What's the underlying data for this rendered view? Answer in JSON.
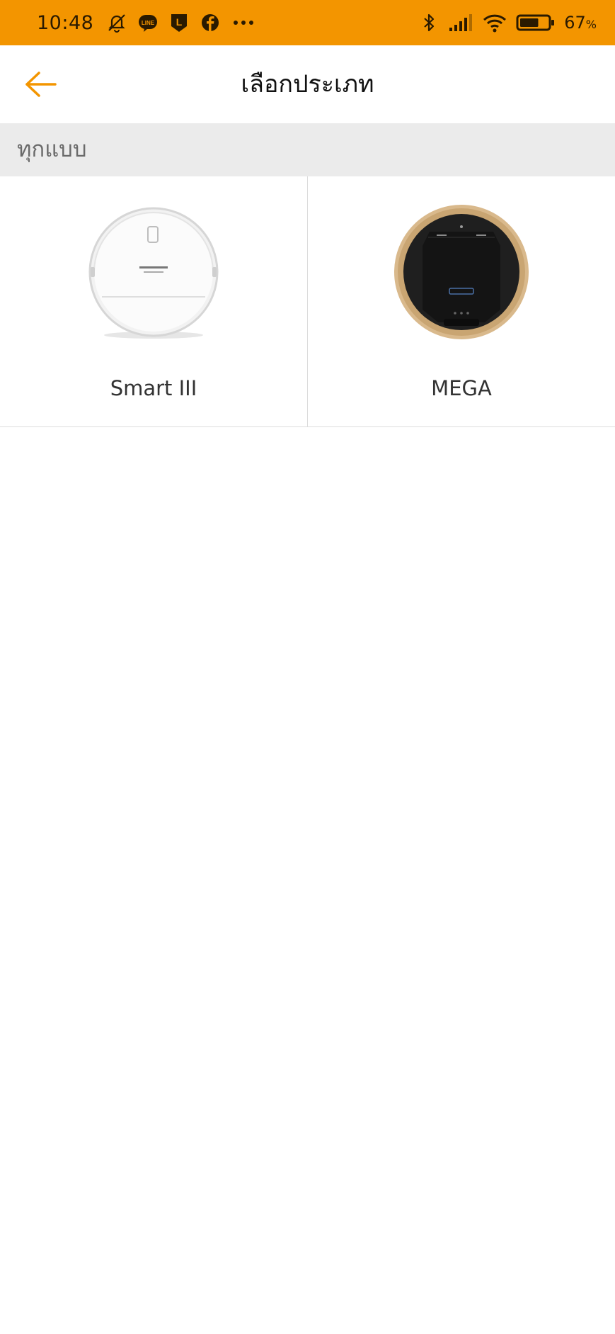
{
  "status_bar": {
    "time": "10:48",
    "notification_icons": [
      "mute-bell-icon",
      "line-icon",
      "l-app-icon",
      "facebook-icon",
      "more-dots-icon"
    ],
    "line_text": "LINE",
    "l_text": "L",
    "right_icons": [
      "bluetooth-icon",
      "signal-icon",
      "wifi-icon",
      "battery-icon"
    ],
    "battery_percent": "67",
    "battery_unit": "%",
    "battery_level": 0.67,
    "background_color": "#f39500"
  },
  "app_bar": {
    "title": "เลือกประเภท",
    "back_icon": "arrow-left-icon",
    "accent_color": "#f39500"
  },
  "section": {
    "label": "ทุกแบบ"
  },
  "products": [
    {
      "name": "Smart III",
      "image": "white-robot-vacuum"
    },
    {
      "name": "MEGA",
      "image": "black-gold-robot-vacuum"
    }
  ]
}
